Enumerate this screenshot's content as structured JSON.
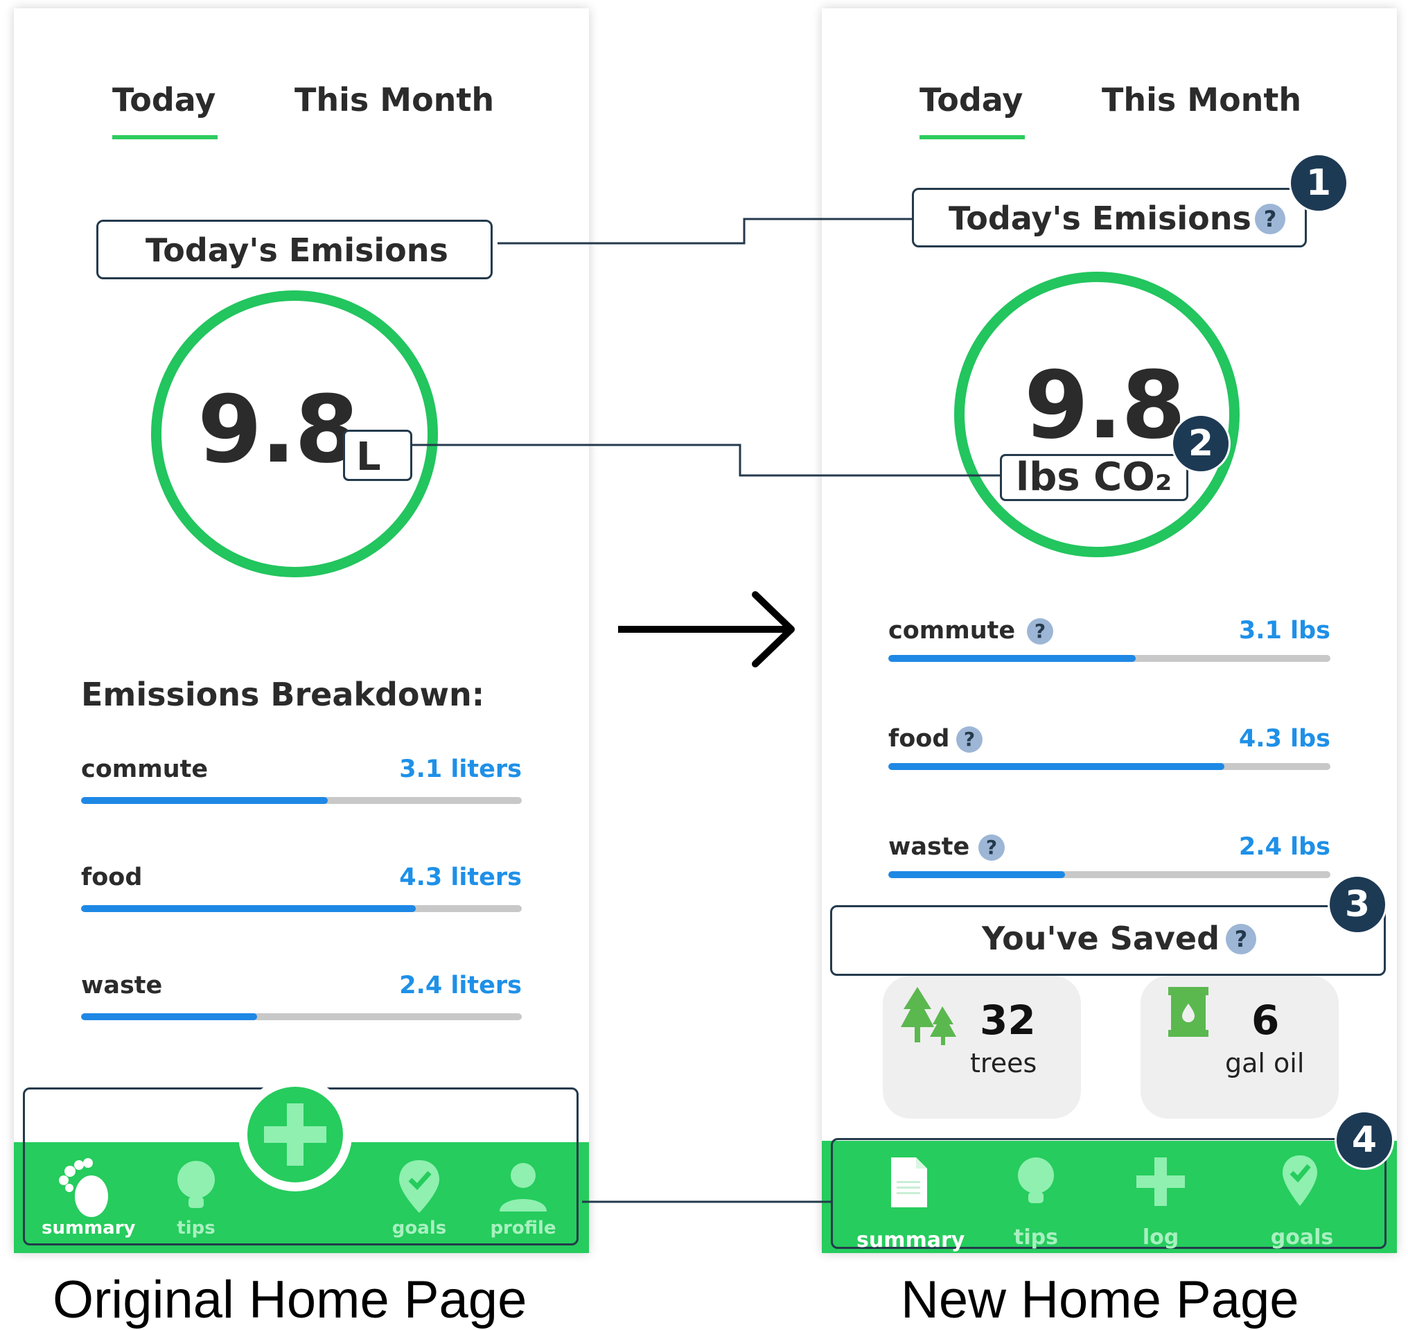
{
  "original": {
    "tabs": [
      "Today",
      "This Month"
    ],
    "emissions_title": "Today's Emisions",
    "value": "9.8",
    "unit": "L",
    "breakdown_title": "Emissions Breakdown:",
    "breakdown": [
      {
        "label": "commute",
        "value": "3.1 liters",
        "fraction": 0.56
      },
      {
        "label": "food",
        "value": "4.3 liters",
        "fraction": 0.76
      },
      {
        "label": "waste",
        "value": "2.4 liters",
        "fraction": 0.4
      }
    ],
    "nav": [
      "summary",
      "tips",
      "goals",
      "profile"
    ],
    "caption": "Original Home Page"
  },
  "redesign": {
    "tabs": [
      "Today",
      "This Month"
    ],
    "emissions_title": "Today's Emisions",
    "value": "9.8",
    "unit": "lbs CO₂",
    "breakdown": [
      {
        "label": "commute",
        "value": "3.1 lbs",
        "fraction": 0.56
      },
      {
        "label": "food",
        "value": "4.3 lbs",
        "fraction": 0.76
      },
      {
        "label": "waste",
        "value": "2.4 lbs",
        "fraction": 0.4
      }
    ],
    "saved_title": "You've Saved",
    "saved": [
      {
        "num": "32",
        "unit": "trees"
      },
      {
        "num": "6",
        "unit": "gal oil"
      }
    ],
    "nav": [
      "summary",
      "tips",
      "log",
      "goals"
    ],
    "caption": "New Home Page",
    "help_glyph": "?"
  },
  "badges": [
    "1",
    "2",
    "3",
    "4"
  ],
  "colors": {
    "accent_green": "#22c55e",
    "bar_blue": "#1e88e5",
    "value_blue": "#1e90e8",
    "badge_navy": "#1d3a55"
  }
}
